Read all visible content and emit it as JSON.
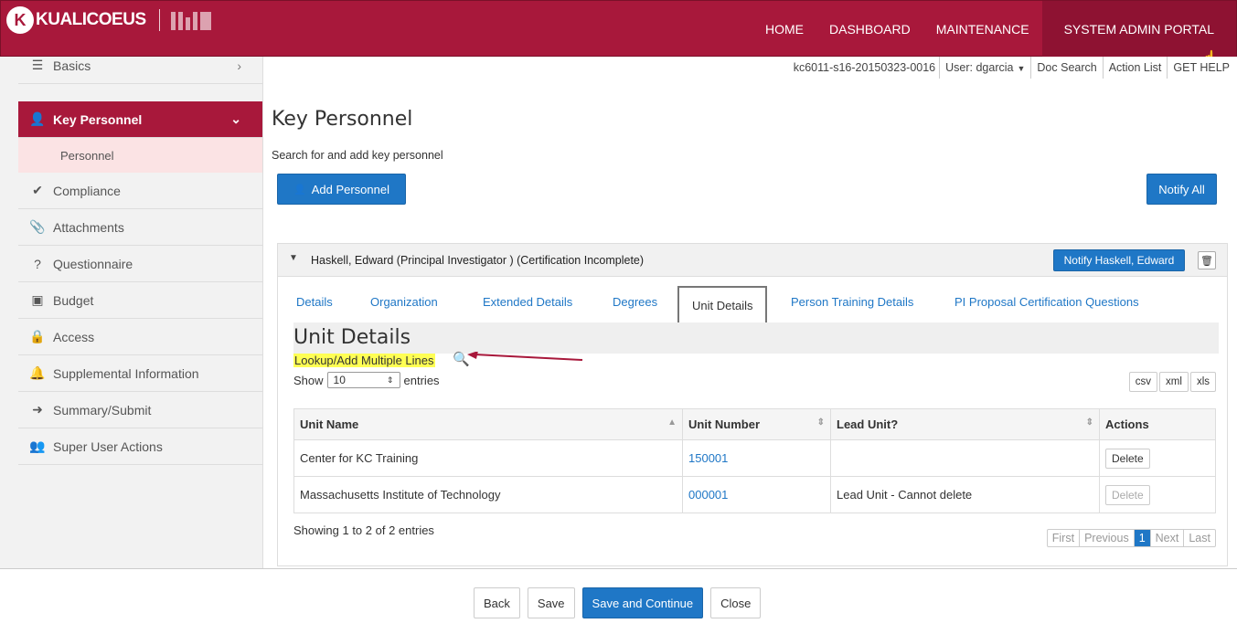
{
  "brand": {
    "name": "KUALICOEUS",
    "k_mark": "K"
  },
  "nav": [
    "HOME",
    "DASHBOARD",
    "MAINTENANCE",
    "SYSTEM ADMIN PORTAL"
  ],
  "util": {
    "doc_id": "kc6011-s16-20150323-0016",
    "user": "User: dgarcia",
    "doc_search": "Doc Search",
    "action_list": "Action List",
    "get_help": "GET HELP"
  },
  "sidebar": {
    "items": [
      {
        "label": "Basics",
        "icon": "list-icon"
      },
      {
        "label": "Key Personnel",
        "icon": "user-icon"
      },
      {
        "label": "Compliance",
        "icon": "check-icon"
      },
      {
        "label": "Attachments",
        "icon": "paperclip-icon"
      },
      {
        "label": "Questionnaire",
        "icon": "question-icon"
      },
      {
        "label": "Budget",
        "icon": "money-icon"
      },
      {
        "label": "Access",
        "icon": "lock-icon"
      },
      {
        "label": "Supplemental Information",
        "icon": "bell-icon"
      },
      {
        "label": "Summary/Submit",
        "icon": "sign-in-icon"
      },
      {
        "label": "Super User Actions",
        "icon": "users-icon"
      }
    ],
    "sub_item": "Personnel"
  },
  "main": {
    "title": "Key Personnel",
    "subtitle": "Search for and add key personnel",
    "add_personnel": "Add Personnel",
    "notify_all": "Notify All",
    "person": {
      "name": "Haskell, Edward (Principal Investigator ) (Certification Incomplete)",
      "notify": "Notify Haskell, Edward"
    },
    "tabs": [
      "Details",
      "Organization",
      "Extended Details",
      "Degrees",
      "Unit Details",
      "Person Training Details",
      "PI Proposal Certification Questions"
    ],
    "unit_details": {
      "heading": "Unit Details",
      "lookup": "Lookup/Add Multiple Lines",
      "show": "Show",
      "entries_value": "10",
      "entries": "entries",
      "exports": [
        "csv",
        "xml",
        "xls"
      ],
      "columns": [
        "Unit Name",
        "Unit Number",
        "Lead Unit?",
        "Actions"
      ],
      "rows": [
        {
          "unit_name": "Center for KC Training",
          "unit_number": "150001",
          "lead_unit": "",
          "action": "Delete"
        },
        {
          "unit_name": "Massachusetts Institute of Technology",
          "unit_number": "000001",
          "lead_unit": "Lead Unit - Cannot delete",
          "action": "Delete"
        }
      ],
      "showing": "Showing 1 to 2 of 2 entries",
      "pager": [
        "First",
        "Previous",
        "1",
        "Next",
        "Last"
      ]
    }
  },
  "footer": {
    "back": "Back",
    "save": "Save",
    "save_continue": "Save and Continue",
    "close": "Close"
  },
  "colors": {
    "brand": "#a8183b",
    "primary": "#1f77c6",
    "highlight": "#ffff54"
  }
}
